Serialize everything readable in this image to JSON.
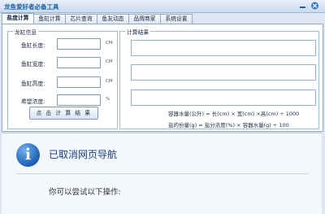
{
  "window": {
    "title": "龙鱼爱好者必备工具"
  },
  "tabs": [
    {
      "label": "盐度计算"
    },
    {
      "label": "鱼缸计算"
    },
    {
      "label": "芯片查询"
    },
    {
      "label": "鱼友动态"
    },
    {
      "label": "品牌商家"
    },
    {
      "label": "系统设置"
    }
  ],
  "tank_info": {
    "legend": "龙缸信息",
    "fields": [
      {
        "label": "鱼缸长度:",
        "unit": "CM",
        "value": ""
      },
      {
        "label": "鱼缸宽度:",
        "unit": "CM",
        "value": ""
      },
      {
        "label": "鱼缸高度:",
        "unit": "CM",
        "value": ""
      },
      {
        "label": "希望浓度:",
        "unit": "%",
        "value": ""
      }
    ],
    "calc_button": "点 击 计 算 结 果"
  },
  "results": {
    "legend": "计算结果",
    "fields": [
      {
        "value": ""
      },
      {
        "value": ""
      },
      {
        "value": ""
      }
    ],
    "formula_volume": "容器水量(公升) = 长(cm) × 宽(cm) ×高(cm) ÷ 1000",
    "formula_salt": "盐的份量(g) = 盐分浓度(%) × 容器水量(g) ÷ 100"
  },
  "browser": {
    "title": "已取消网页导航",
    "subtitle": "你可以尝试以下操作:"
  }
}
